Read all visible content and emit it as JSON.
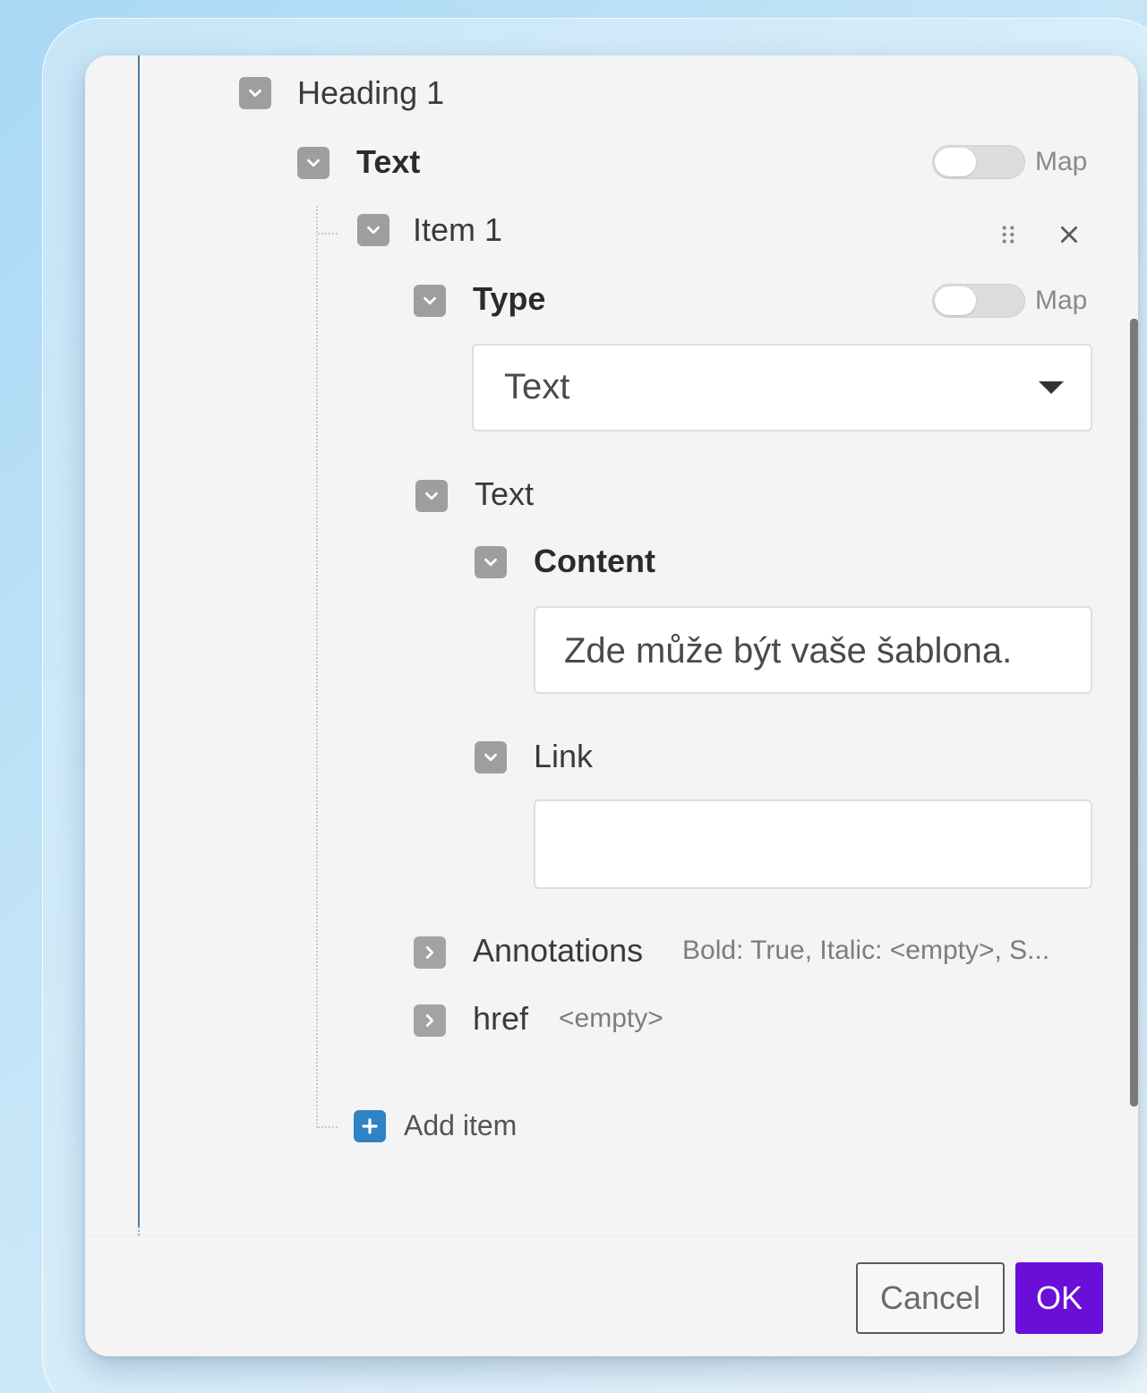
{
  "tree": {
    "heading1": "Heading 1",
    "text_section": "Text",
    "item1": "Item 1",
    "type_label": "Type",
    "type_select_value": "Text",
    "text_sub": "Text",
    "content_label": "Content",
    "content_value": "Zde může být vaše šablona.",
    "link_label": "Link",
    "link_value": "",
    "annotations_label": "Annotations",
    "annotations_summary": "Bold: True, Italic: <empty>, S...",
    "href_label": "href",
    "href_summary": "<empty>",
    "add_item": "Add item"
  },
  "toggles": {
    "text_map_label": "Map",
    "type_map_label": "Map"
  },
  "footer": {
    "cancel_label": "Cancel",
    "ok_label": "OK"
  },
  "colors": {
    "ok_button": "#6a0fd8",
    "add_button": "#2f83c3",
    "left_rule": "#4d7c9f"
  }
}
